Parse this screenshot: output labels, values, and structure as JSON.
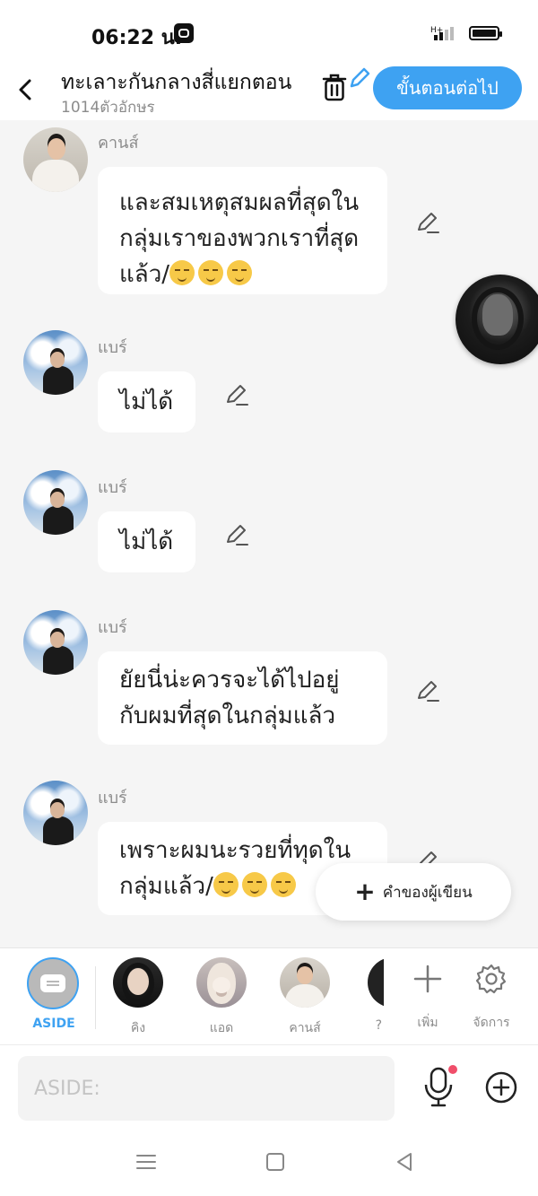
{
  "status_bar": {
    "time": "06:22 น."
  },
  "header": {
    "title": "ทะเลาะกันกลางสี่แยกตอน",
    "char_count": "1014ตัวอักษร",
    "next_label": "ขั้นตอนต่อไป"
  },
  "messages": [
    {
      "sender": "คานส์",
      "text": "และสมเหตุสมผลที่สุดในกลุ่มเราของพวกเราที่สุดแล้ว/",
      "emoji_count": 3
    },
    {
      "sender": "แบร์",
      "text": "ไม่ได้"
    },
    {
      "sender": "แบร์",
      "text": "ไม่ได้"
    },
    {
      "sender": "แบร์",
      "text": "ยัยนี่น่ะควรจะได้ไปอยู่กับผมที่สุดในกลุ่มแล้ว"
    },
    {
      "sender": "แบร์",
      "text": "เพราะผมนะรวยที่ทุดในกลุ่มแล้ว/",
      "emoji_count": 3
    }
  ],
  "author_note_label": "คำของผู้เขียน",
  "characters": {
    "aside_label": "ASIDE",
    "items": [
      {
        "name": "คิง"
      },
      {
        "name": "แอด"
      },
      {
        "name": "คานส์"
      },
      {
        "name": "?"
      }
    ],
    "add_label": "เพิ่ม",
    "manage_label": "จัดการ"
  },
  "input": {
    "placeholder": "ASIDE:"
  },
  "colors": {
    "accent": "#3ea2f2",
    "bubble": "#ffffff",
    "background": "#f5f5f5",
    "notification_dot": "#f04e6a"
  }
}
